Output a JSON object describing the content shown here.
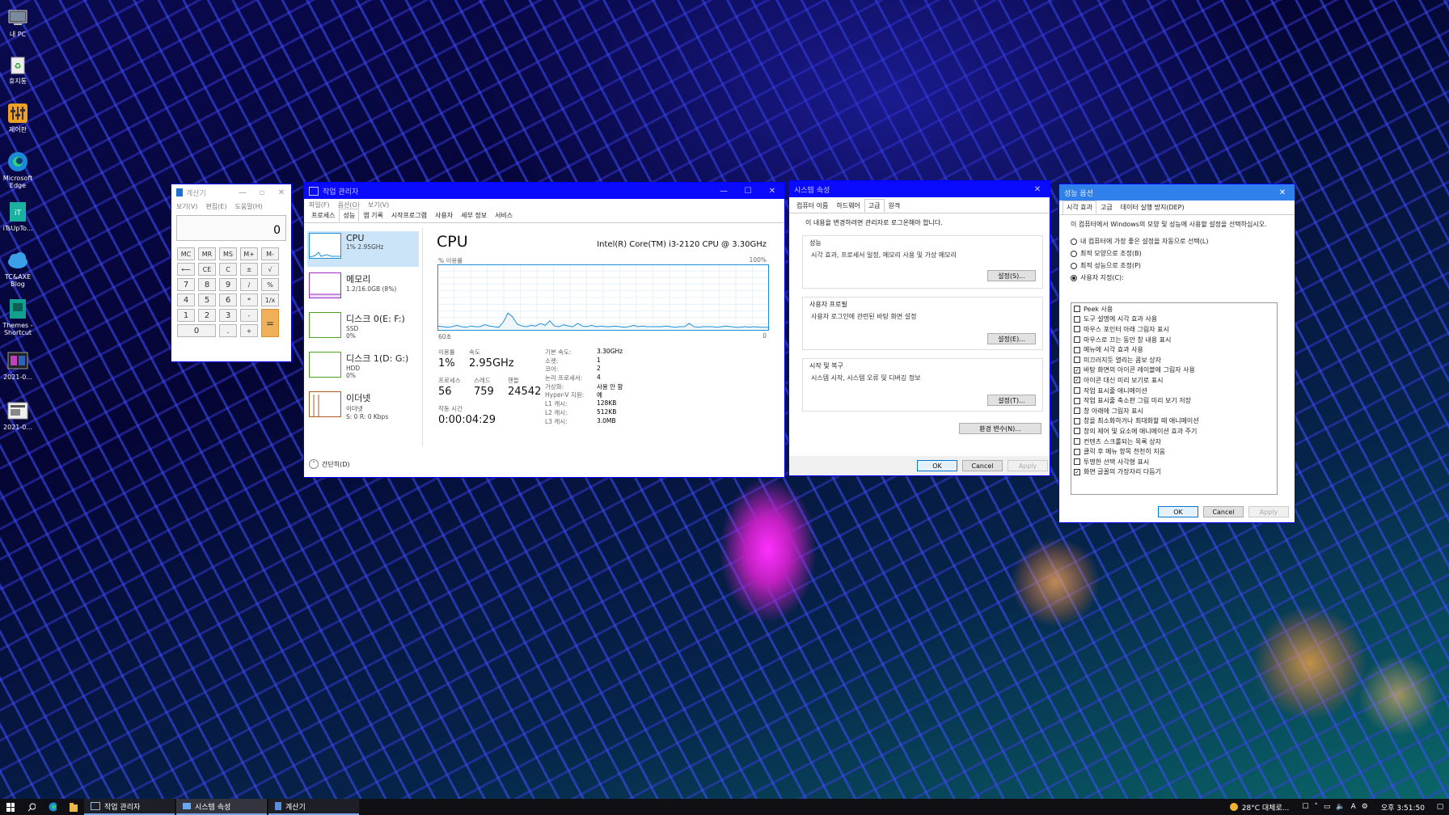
{
  "desktop": {
    "icons": [
      {
        "label": "내 PC"
      },
      {
        "label": "휴지통"
      },
      {
        "label": "제어판"
      },
      {
        "label": "Microsoft Edge"
      },
      {
        "label": "iTsUpTo..."
      },
      {
        "label": "TC&AXE Blog"
      },
      {
        "label": "Themes - Shortcut"
      },
      {
        "label": "2021-0..."
      },
      {
        "label": "2021-0..."
      }
    ]
  },
  "calculator": {
    "title": "계산기",
    "menu": [
      "보기(V)",
      "편집(E)",
      "도움말(H)"
    ],
    "display": "0",
    "keys": [
      "MC",
      "MR",
      "MS",
      "M+",
      "M-",
      "⟵",
      "CE",
      "C",
      "±",
      "√",
      "7",
      "8",
      "9",
      "/",
      "%",
      "4",
      "5",
      "6",
      "*",
      "1/x",
      "1",
      "2",
      "3",
      "-",
      "=",
      "0",
      ".",
      "+"
    ]
  },
  "taskmgr": {
    "title": "작업 관리자",
    "menu": [
      "파일(F)",
      "옵션(O)",
      "보기(V)"
    ],
    "tabs": [
      "프로세스",
      "성능",
      "앱 기록",
      "시작프로그램",
      "사용자",
      "세부 정보",
      "서비스"
    ],
    "active_tab": "성능",
    "side_items": [
      {
        "name": "CPU",
        "sub1": "1% 2.95GHz",
        "sub2": "",
        "color": "#1c8fd8"
      },
      {
        "name": "메모리",
        "sub1": "1.2/16.0GB (8%)",
        "sub2": "",
        "color": "#9b2cc7"
      },
      {
        "name": "디스크 0(E: F:)",
        "sub1": "SSD",
        "sub2": "0%",
        "color": "#4aa51f"
      },
      {
        "name": "디스크 1(D: G:)",
        "sub1": "HDD",
        "sub2": "0%",
        "color": "#4aa51f"
      },
      {
        "name": "이더넷",
        "sub1": "이더넷",
        "sub2": "S: 0 R: 0 Kbps",
        "color": "#b35a1f"
      }
    ],
    "main": {
      "heading": "CPU",
      "model": "Intel(R) Core(TM) i3-2120 CPU @ 3.30GHz",
      "graph_label": "% 이용률",
      "graph_max": "100%",
      "graph_left": "60초",
      "graph_right": "0",
      "utilization_label": "이용률",
      "utilization": "1%",
      "speed_label": "속도",
      "speed": "2.95GHz",
      "processes_label": "프로세스",
      "processes": "56",
      "threads_label": "스레드",
      "threads": "759",
      "handles_label": "핸들",
      "handles": "24542",
      "uptime_label": "작동 시간",
      "uptime": "0:00:04:29",
      "specs": [
        {
          "k": "기본 속도:",
          "v": "3.30GHz"
        },
        {
          "k": "소켓:",
          "v": "1"
        },
        {
          "k": "코어:",
          "v": "2"
        },
        {
          "k": "논리 프로세서:",
          "v": "4"
        },
        {
          "k": "가상화:",
          "v": "사용 안 함"
        },
        {
          "k": "Hyper-V 지원:",
          "v": "예"
        },
        {
          "k": "L1 캐시:",
          "v": "128KB"
        },
        {
          "k": "L2 캐시:",
          "v": "512KB"
        },
        {
          "k": "L3 캐시:",
          "v": "3.0MB"
        }
      ],
      "cpu_history": [
        6,
        5,
        4,
        5,
        7,
        5,
        4,
        6,
        5,
        5,
        8,
        6,
        5,
        4,
        12,
        26,
        20,
        9,
        6,
        5,
        7,
        6,
        10,
        7,
        14,
        6,
        5,
        8,
        6,
        5,
        10,
        6,
        5,
        7,
        5,
        6,
        5,
        5,
        6,
        5,
        4,
        5,
        7,
        5,
        6,
        5,
        5,
        5,
        5,
        6,
        5,
        4,
        5,
        5,
        10,
        5,
        4,
        5,
        5,
        5,
        4,
        5,
        6,
        5,
        4,
        4,
        5,
        4,
        5,
        4,
        4,
        4
      ]
    },
    "fewer_details": "간단히(D)"
  },
  "sysprops": {
    "title": "시스템 속성",
    "tabs": [
      "컴퓨터 이름",
      "하드웨어",
      "고급",
      "원격"
    ],
    "active_tab": "고급",
    "admin_note": "이 내용을 변경하려면 관리자로 로그온해야 합니다.",
    "groups": [
      {
        "title": "성능",
        "desc": "시각 효과, 프로세서 일정, 메모리 사용 및 가상 메모리",
        "button": "설정(S)..."
      },
      {
        "title": "사용자 프로필",
        "desc": "사용자 로그인에 관련된 바탕 화면 설정",
        "button": "설정(E)..."
      },
      {
        "title": "시작 및 복구",
        "desc": "시스템 시작, 시스템 오류 및 디버깅 정보",
        "button": "설정(T)..."
      }
    ],
    "env_button": "환경 변수(N)...",
    "ok": "OK",
    "cancel": "Cancel",
    "apply": "Apply"
  },
  "perfopts": {
    "title": "성능 옵션",
    "tabs": [
      "시각 효과",
      "고급",
      "데이터 실행 방지(DEP)"
    ],
    "active_tab": "시각 효과",
    "intro": "이 컴퓨터에서 Windows의 모양 및 성능에 사용할 설정을 선택하십시오.",
    "radios": [
      {
        "label": "내 컴퓨터에 가장 좋은 설정을 자동으로 선택(L)",
        "checked": false
      },
      {
        "label": "최적 모양으로 조정(B)",
        "checked": false
      },
      {
        "label": "최적 성능으로 조정(P)",
        "checked": false
      },
      {
        "label": "사용자 지정(C):",
        "checked": true
      }
    ],
    "checks": [
      {
        "label": "Peek 사용",
        "checked": false
      },
      {
        "label": "도구 설명에 시각 효과 사용",
        "checked": false
      },
      {
        "label": "마우스 포인터 아래 그림자 표시",
        "checked": false
      },
      {
        "label": "마우스로 끄는 동안 창 내용 표시",
        "checked": false
      },
      {
        "label": "메뉴에 시각 효과 사용",
        "checked": false
      },
      {
        "label": "미끄러지듯 열리는 콤보 상자",
        "checked": false
      },
      {
        "label": "바탕 화면의 아이콘 레이블에 그림자 사용",
        "checked": true
      },
      {
        "label": "아이콘 대신 미리 보기로 표시",
        "checked": true
      },
      {
        "label": "작업 표시줄 애니메이션",
        "checked": false
      },
      {
        "label": "작업 표시줄 축소판 그림 미리 보기 저장",
        "checked": false
      },
      {
        "label": "창 아래에 그림자 표시",
        "checked": false
      },
      {
        "label": "창을 최소화하거나 최대화할 때 애니메이션",
        "checked": false
      },
      {
        "label": "창의 제어 및 요소에 애니메이션 효과 주기",
        "checked": false
      },
      {
        "label": "컨텐츠 스크롤되는 목록 상자",
        "checked": false
      },
      {
        "label": "클릭 후 메뉴 항목 천천히 지움",
        "checked": false
      },
      {
        "label": "투명한 선택 사각형 표시",
        "checked": false
      },
      {
        "label": "화면 글꼴의 가장자리 다듬기",
        "checked": true
      }
    ],
    "ok": "OK",
    "cancel": "Cancel",
    "apply": "Apply"
  },
  "taskbar": {
    "apps": [
      {
        "label": "작업 관리자",
        "active": false
      },
      {
        "label": "시스템 속성",
        "active": true
      },
      {
        "label": "계산기",
        "active": false
      }
    ],
    "weather": "28°C 대체로...",
    "time": "오후 3:51:50"
  }
}
